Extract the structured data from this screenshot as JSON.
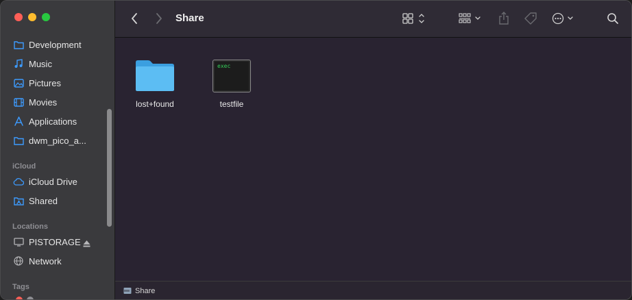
{
  "window": {
    "title": "Share"
  },
  "sidebar": {
    "favorites": [
      {
        "label": "Development",
        "icon": "folder-icon"
      },
      {
        "label": "Music",
        "icon": "music-note-icon"
      },
      {
        "label": "Pictures",
        "icon": "photo-icon"
      },
      {
        "label": "Movies",
        "icon": "film-icon"
      },
      {
        "label": "Applications",
        "icon": "applications-icon"
      },
      {
        "label": "dwm_pico_a...",
        "icon": "folder-icon"
      }
    ],
    "icloud_heading": "iCloud",
    "icloud": [
      {
        "label": "iCloud Drive",
        "icon": "cloud-icon"
      },
      {
        "label": "Shared",
        "icon": "shared-folder-icon"
      }
    ],
    "locations_heading": "Locations",
    "locations": [
      {
        "label": "PISTORAGE",
        "icon": "drive-icon",
        "eject": true
      },
      {
        "label": "Network",
        "icon": "globe-icon"
      }
    ],
    "tags_heading": "Tags"
  },
  "toolbar": {
    "back": "back-chevron-icon",
    "forward": "forward-chevron-icon",
    "view": "icon-grid-view-icon",
    "group": "group-by-icon",
    "share": "share-icon",
    "tag": "tag-icon",
    "more": "ellipsis-circle-icon",
    "search": "search-icon"
  },
  "content": {
    "items": [
      {
        "name": "lost+found",
        "kind": "folder"
      },
      {
        "name": "testfile",
        "kind": "executable",
        "badge": "exec"
      }
    ]
  },
  "pathbar": {
    "label": "Share"
  },
  "colors": {
    "accent": "#0a84ff",
    "folder": "#4fb8f0"
  }
}
